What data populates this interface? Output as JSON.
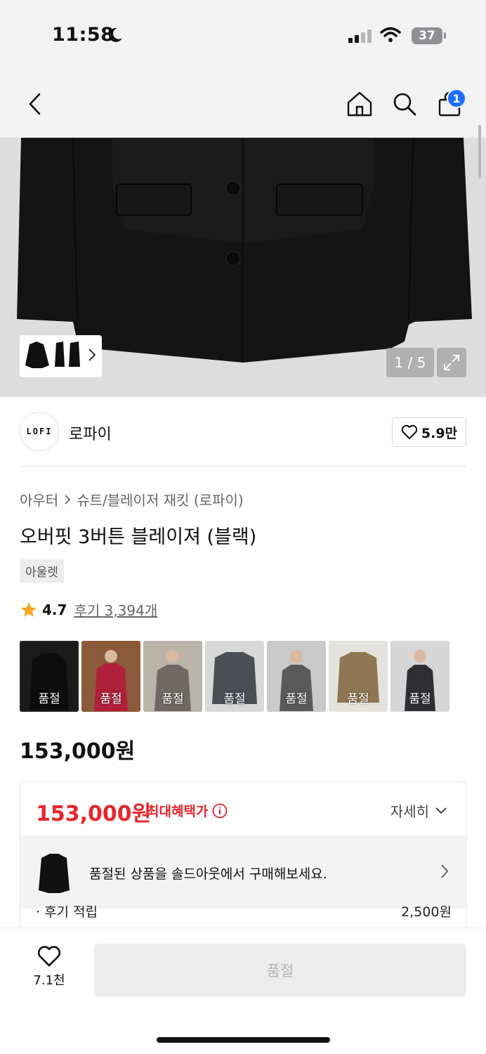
{
  "status": {
    "time": "11:58",
    "battery": "37"
  },
  "nav": {
    "cart_count": "1"
  },
  "gallery": {
    "counter": "1 / 5"
  },
  "brand": {
    "logo_text": "LOFI",
    "name": "로파이",
    "likes": "5.9만"
  },
  "product": {
    "breadcrumb": [
      "아우터",
      "슈트/블레이저 재킷 (로파이)"
    ],
    "title": "오버핏 3버튼 블레이져 (블랙)",
    "tag": "아울렛",
    "rating": "4.7",
    "reviews": "후기 3,394개",
    "price": "153,000원"
  },
  "swatches": [
    {
      "label": "품절",
      "bg": "#1a1a1a",
      "fg": "#0d0d0d"
    },
    {
      "label": "품절",
      "bg": "#8a5a3a",
      "fg": "#b0203a"
    },
    {
      "label": "품절",
      "bg": "#b9b3a8",
      "fg": "#6e6a63"
    },
    {
      "label": "품절",
      "bg": "#d8d8d8",
      "fg": "#4b4e55"
    },
    {
      "label": "품절",
      "bg": "#c9c9c9",
      "fg": "#5a5a5a"
    },
    {
      "label": "품절",
      "bg": "#e4e2dc",
      "fg": "#8d7651"
    },
    {
      "label": "품절",
      "bg": "#d6d6d6",
      "fg": "#2e2e33"
    }
  ],
  "benefit": {
    "price": "153,000원",
    "label": "최대혜택가",
    "detail": "자세히",
    "soldout_msg": "품절된 상품을 솔드아웃에서 구매해보세요.",
    "row_label": "· 후기 적립",
    "row_value": "2,500원"
  },
  "bottom": {
    "likes": "7.1천",
    "buy_label": "품절"
  },
  "colors": {
    "accent_red": "#e8262c",
    "badge_blue": "#1f6fff"
  }
}
